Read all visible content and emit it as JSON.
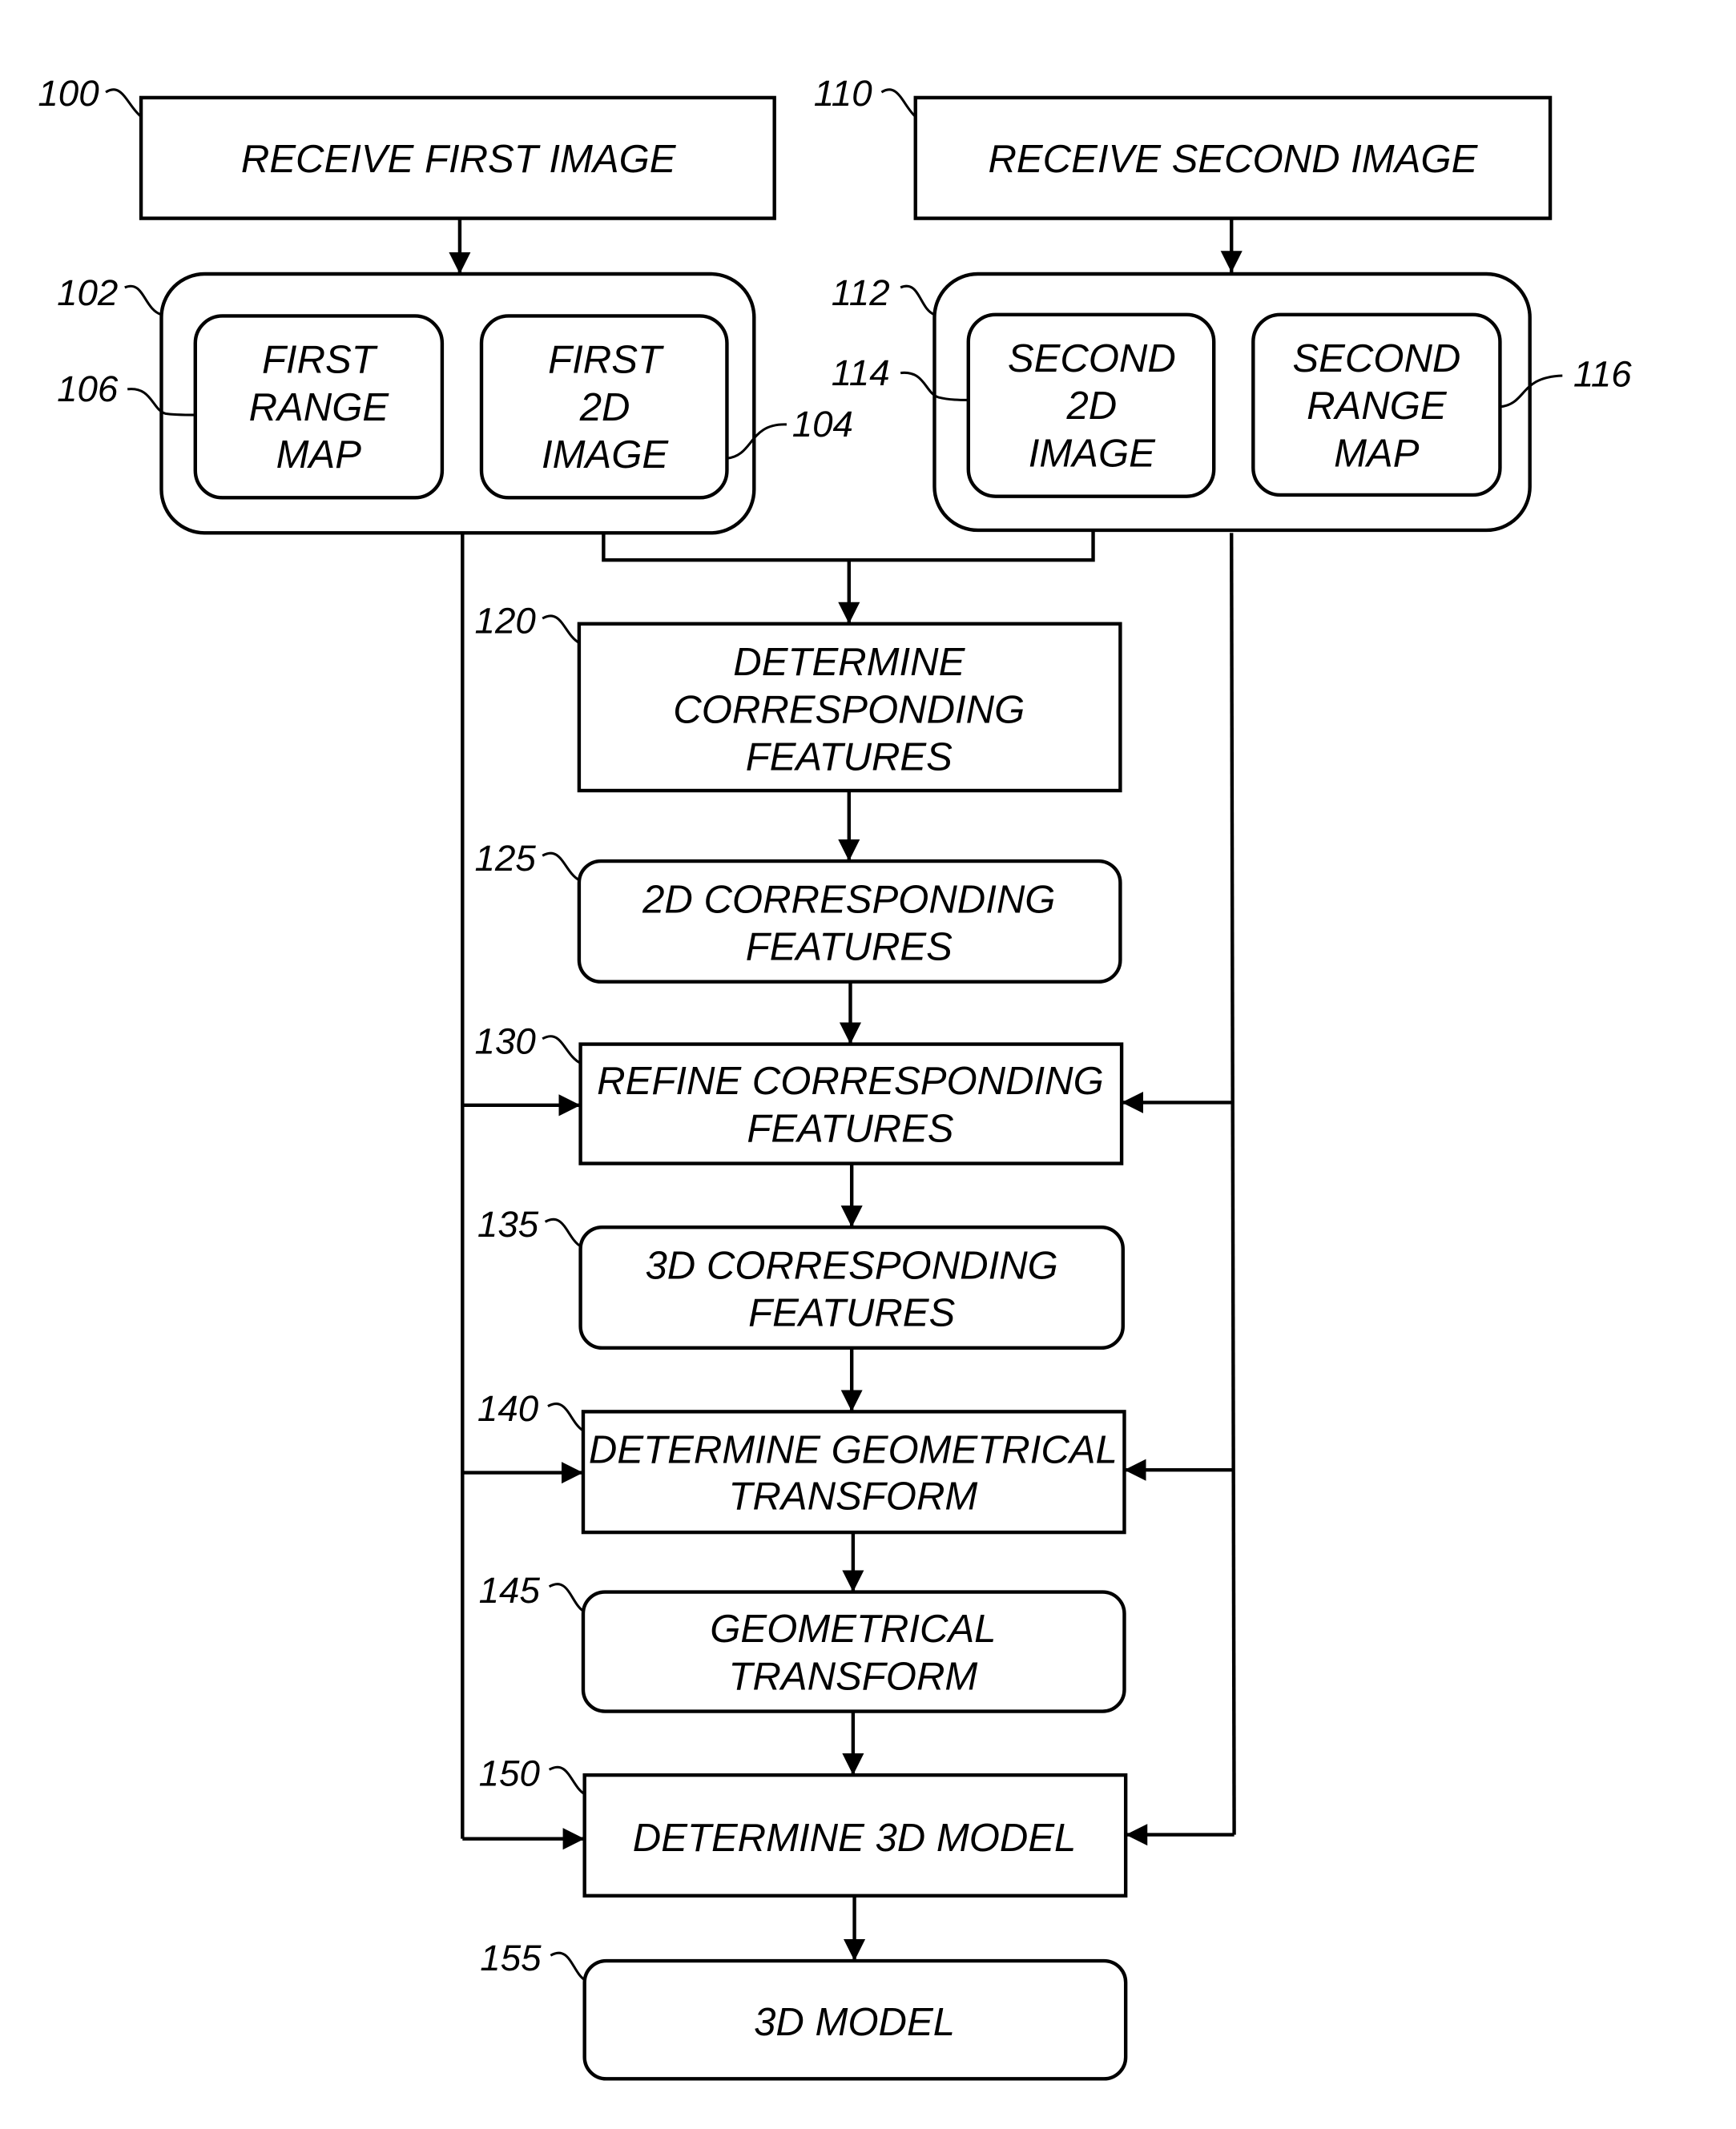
{
  "figure": {
    "blocks": {
      "b100": {
        "ref": "100",
        "lines": [
          "RECEIVE FIRST IMAGE"
        ]
      },
      "b110": {
        "ref": "110",
        "lines": [
          "RECEIVE SECOND IMAGE"
        ]
      },
      "g102": {
        "ref": "102"
      },
      "b106": {
        "ref": "106",
        "lines": [
          "FIRST",
          "RANGE",
          "MAP"
        ]
      },
      "b104": {
        "ref": "104",
        "lines": [
          "FIRST",
          "2D",
          "IMAGE"
        ]
      },
      "g112": {
        "ref": "112"
      },
      "b114": {
        "ref": "114",
        "lines": [
          "SECOND",
          "2D",
          "IMAGE"
        ]
      },
      "b116": {
        "ref": "116",
        "lines": [
          "SECOND",
          "RANGE",
          "MAP"
        ]
      },
      "b120": {
        "ref": "120",
        "lines": [
          "DETERMINE",
          "CORRESPONDING",
          "FEATURES"
        ]
      },
      "b125": {
        "ref": "125",
        "lines": [
          "2D CORRESPONDING",
          "FEATURES"
        ]
      },
      "b130": {
        "ref": "130",
        "lines": [
          "REFINE CORRESPONDING",
          "FEATURES"
        ]
      },
      "b135": {
        "ref": "135",
        "lines": [
          "3D CORRESPONDING",
          "FEATURES"
        ]
      },
      "b140": {
        "ref": "140",
        "lines": [
          "DETERMINE GEOMETRICAL",
          "TRANSFORM"
        ]
      },
      "b145": {
        "ref": "145",
        "lines": [
          "GEOMETRICAL",
          "TRANSFORM"
        ]
      },
      "b150": {
        "ref": "150",
        "lines": [
          "DETERMINE 3D MODEL"
        ]
      },
      "b155": {
        "ref": "155",
        "lines": [
          "3D MODEL"
        ]
      }
    }
  }
}
